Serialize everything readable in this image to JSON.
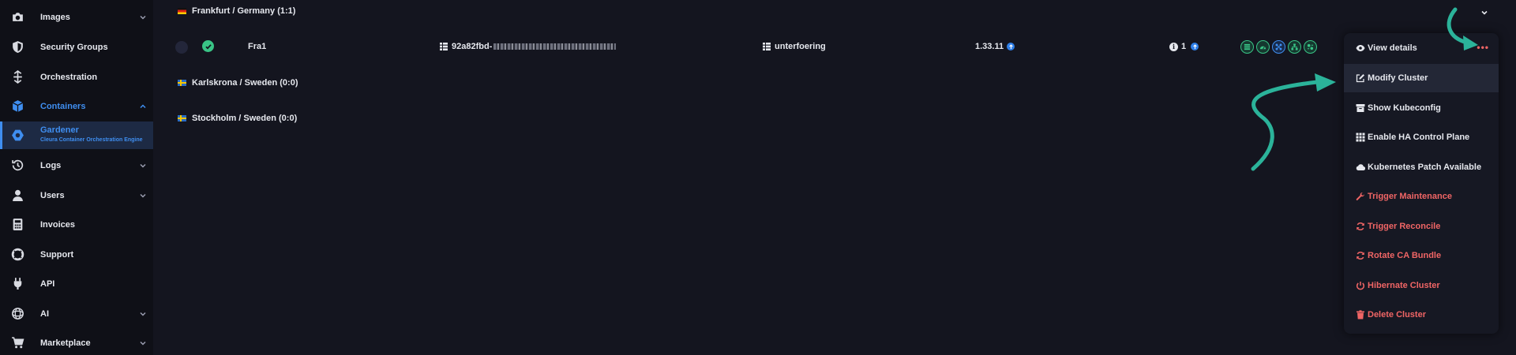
{
  "sidebar": {
    "items": [
      {
        "label": "Images",
        "icon": "camera-icon",
        "chevron": "down"
      },
      {
        "label": "Security Groups",
        "icon": "shield-icon"
      },
      {
        "label": "Orchestration",
        "icon": "orchestration-icon"
      },
      {
        "label": "Containers",
        "icon": "cube-icon",
        "chevron": "up",
        "highlight": true
      },
      {
        "label": "Gardener",
        "sublabel": "Cleura Container Orchestration Engine",
        "icon": "gardener-icon",
        "active": true
      },
      {
        "label": "Logs",
        "icon": "history-icon",
        "chevron": "down"
      },
      {
        "label": "Users",
        "icon": "user-icon",
        "chevron": "down"
      },
      {
        "label": "Invoices",
        "icon": "calculator-icon"
      },
      {
        "label": "Support",
        "icon": "lifebuoy-icon"
      },
      {
        "label": "API",
        "icon": "plug-icon"
      },
      {
        "label": "AI",
        "icon": "ai-icon",
        "chevron": "down"
      },
      {
        "label": "Marketplace",
        "icon": "cart-icon",
        "chevron": "down"
      }
    ]
  },
  "regions": [
    {
      "label": "Frankfurt / Germany (1:1)",
      "flag": "de"
    },
    {
      "label": "Karlskrona / Sweden (0:0)",
      "flag": "se"
    },
    {
      "label": "Stockholm / Sweden (0:0)",
      "flag": "se"
    }
  ],
  "cluster": {
    "name": "Fra1",
    "id_prefix": "92a82fbd-",
    "project": "unterfoering",
    "version": "1.33.11",
    "alerts_count": "1"
  },
  "colors": {
    "accent": "#3f8ef0",
    "success": "#39c486",
    "danger": "#f06565",
    "arrow": "#2bb39a"
  },
  "menu": {
    "items": [
      {
        "label": "View details",
        "icon": "eye-icon"
      },
      {
        "label": "Modify Cluster",
        "icon": "edit-icon",
        "hovered": true
      },
      {
        "label": "Show Kubeconfig",
        "icon": "archive-icon"
      },
      {
        "label": "Enable HA Control Plane",
        "icon": "grid-icon"
      },
      {
        "label": "Kubernetes Patch Available",
        "icon": "cloud-icon"
      },
      {
        "label": "Trigger Maintenance",
        "icon": "wrench-icon",
        "danger": true
      },
      {
        "label": "Trigger Reconcile",
        "icon": "sync-icon",
        "danger": true
      },
      {
        "label": "Rotate CA Bundle",
        "icon": "sync-icon",
        "danger": true
      },
      {
        "label": "Hibernate Cluster",
        "icon": "power-icon",
        "danger": true
      },
      {
        "label": "Delete Cluster",
        "icon": "trash-icon",
        "danger": true
      }
    ]
  }
}
